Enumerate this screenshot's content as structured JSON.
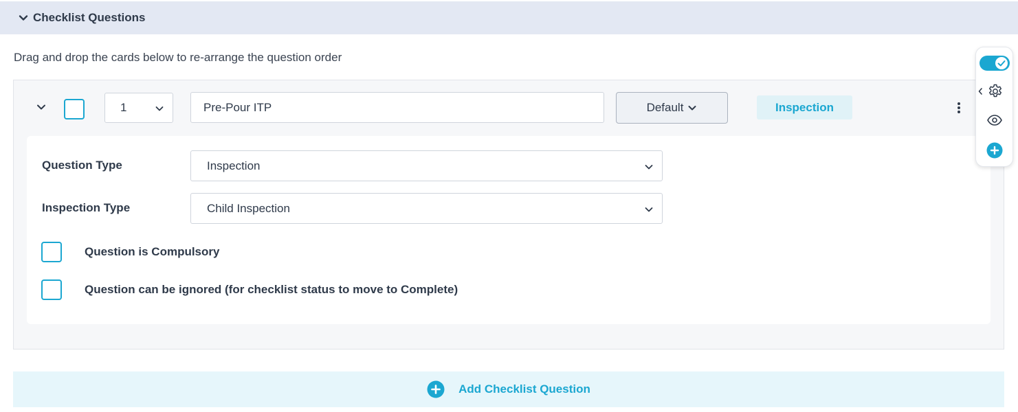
{
  "section": {
    "title": "Checklist Questions"
  },
  "hint": "Drag and drop the cards below to re-arrange the question order",
  "question": {
    "order": "1",
    "name": "Pre-Pour ITP",
    "default_label": "Default",
    "type_badge": "Inspection",
    "fields": {
      "question_type_label": "Question Type",
      "question_type_value": "Inspection",
      "inspection_type_label": "Inspection Type",
      "inspection_type_value": "Child Inspection"
    },
    "options": {
      "compulsory_label": "Question is Compulsory",
      "ignorable_label": "Question can be ignored (for checklist status to move to Complete)"
    }
  },
  "add_button": {
    "label": "Add Checklist Question"
  },
  "toolbar": {
    "toggle_on": true,
    "icons": [
      "check-icon",
      "gear-icon",
      "eye-icon",
      "plus-circle-icon"
    ]
  },
  "colors": {
    "accent": "#1ba7d1",
    "header_bg": "#e3e8f3",
    "text": "#2f3a4a"
  }
}
